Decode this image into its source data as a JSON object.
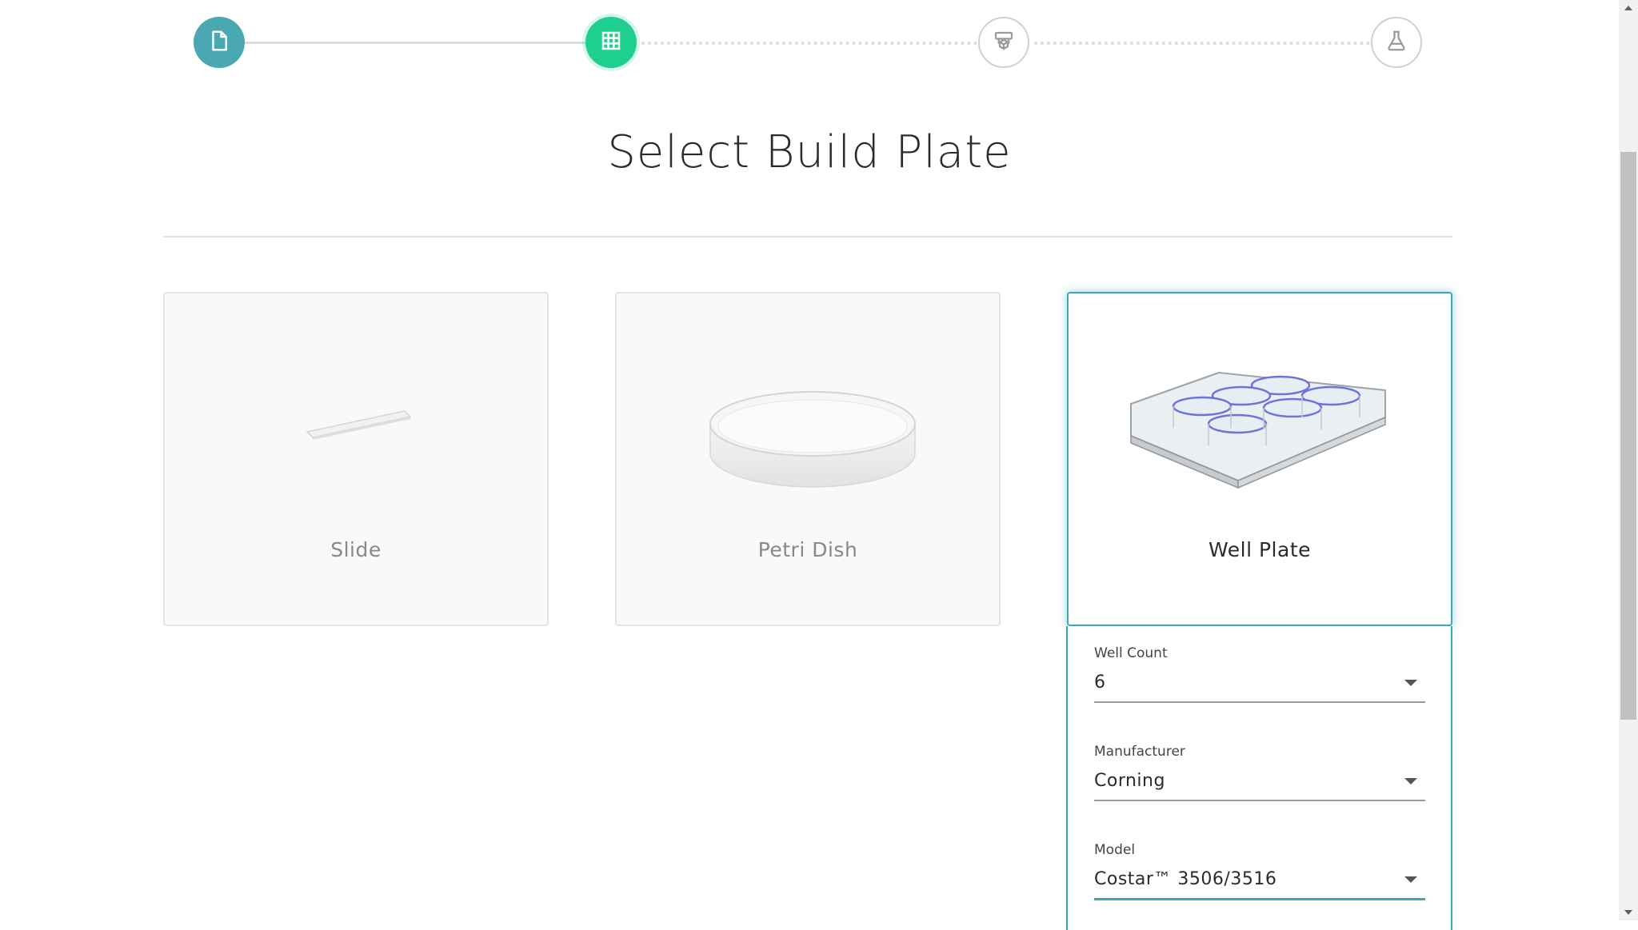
{
  "stepper": {
    "steps": [
      {
        "icon": "document-icon",
        "state": "done"
      },
      {
        "icon": "grid-icon",
        "state": "active"
      },
      {
        "icon": "printer-icon",
        "state": "todo"
      },
      {
        "icon": "flask-icon",
        "state": "todo"
      }
    ]
  },
  "page": {
    "title": "Select Build Plate"
  },
  "plates": [
    {
      "label": "Slide",
      "selected": false
    },
    {
      "label": "Petri Dish",
      "selected": false
    },
    {
      "label": "Well Plate",
      "selected": true
    }
  ],
  "options": {
    "well_count": {
      "label": "Well Count",
      "value": "6"
    },
    "manufacturer": {
      "label": "Manufacturer",
      "value": "Corning"
    },
    "model": {
      "label": "Model",
      "value": "Costar™ 3506/3516"
    }
  },
  "colors": {
    "accent": "#3aa9b5",
    "step_done": "#4aa8b3",
    "step_active": "#1fcf8f"
  }
}
